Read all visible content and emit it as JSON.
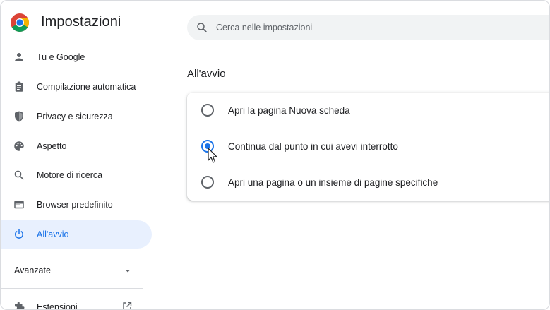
{
  "header": {
    "title": "Impostazioni",
    "logo_icon": "chrome-logo",
    "search": {
      "placeholder": "Cerca nelle impostazioni",
      "icon": "search-icon"
    }
  },
  "sidebar": {
    "items": [
      {
        "label": "Tu e Google",
        "icon": "person-icon",
        "active": false
      },
      {
        "label": "Compilazione automatica",
        "icon": "clipboard-icon",
        "active": false
      },
      {
        "label": "Privacy e sicurezza",
        "icon": "shield-icon",
        "active": false
      },
      {
        "label": "Aspetto",
        "icon": "palette-icon",
        "active": false
      },
      {
        "label": "Motore di ricerca",
        "icon": "search-icon",
        "active": false
      },
      {
        "label": "Browser predefinito",
        "icon": "browser-icon",
        "active": false
      },
      {
        "label": "All'avvio",
        "icon": "power-icon",
        "active": true
      }
    ],
    "advanced": {
      "label": "Avanzate",
      "icon": "chevron-down-icon"
    },
    "extensions": {
      "label": "Estensioni",
      "icon": "puzzle-icon",
      "link_icon": "open-in-new-icon"
    }
  },
  "main": {
    "section_title": "All'avvio",
    "options": [
      {
        "label": "Apri la pagina Nuova scheda",
        "selected": false
      },
      {
        "label": "Continua dal punto in cui avevi interrotto",
        "selected": true
      },
      {
        "label": "Apri una pagina o un insieme di pagine specifiche",
        "selected": false
      }
    ]
  },
  "colors": {
    "accent": "#1a73e8",
    "active_bg": "#e8f0fe",
    "text": "#202124",
    "secondary_text": "#5f6368",
    "search_bg": "#f1f3f4"
  }
}
